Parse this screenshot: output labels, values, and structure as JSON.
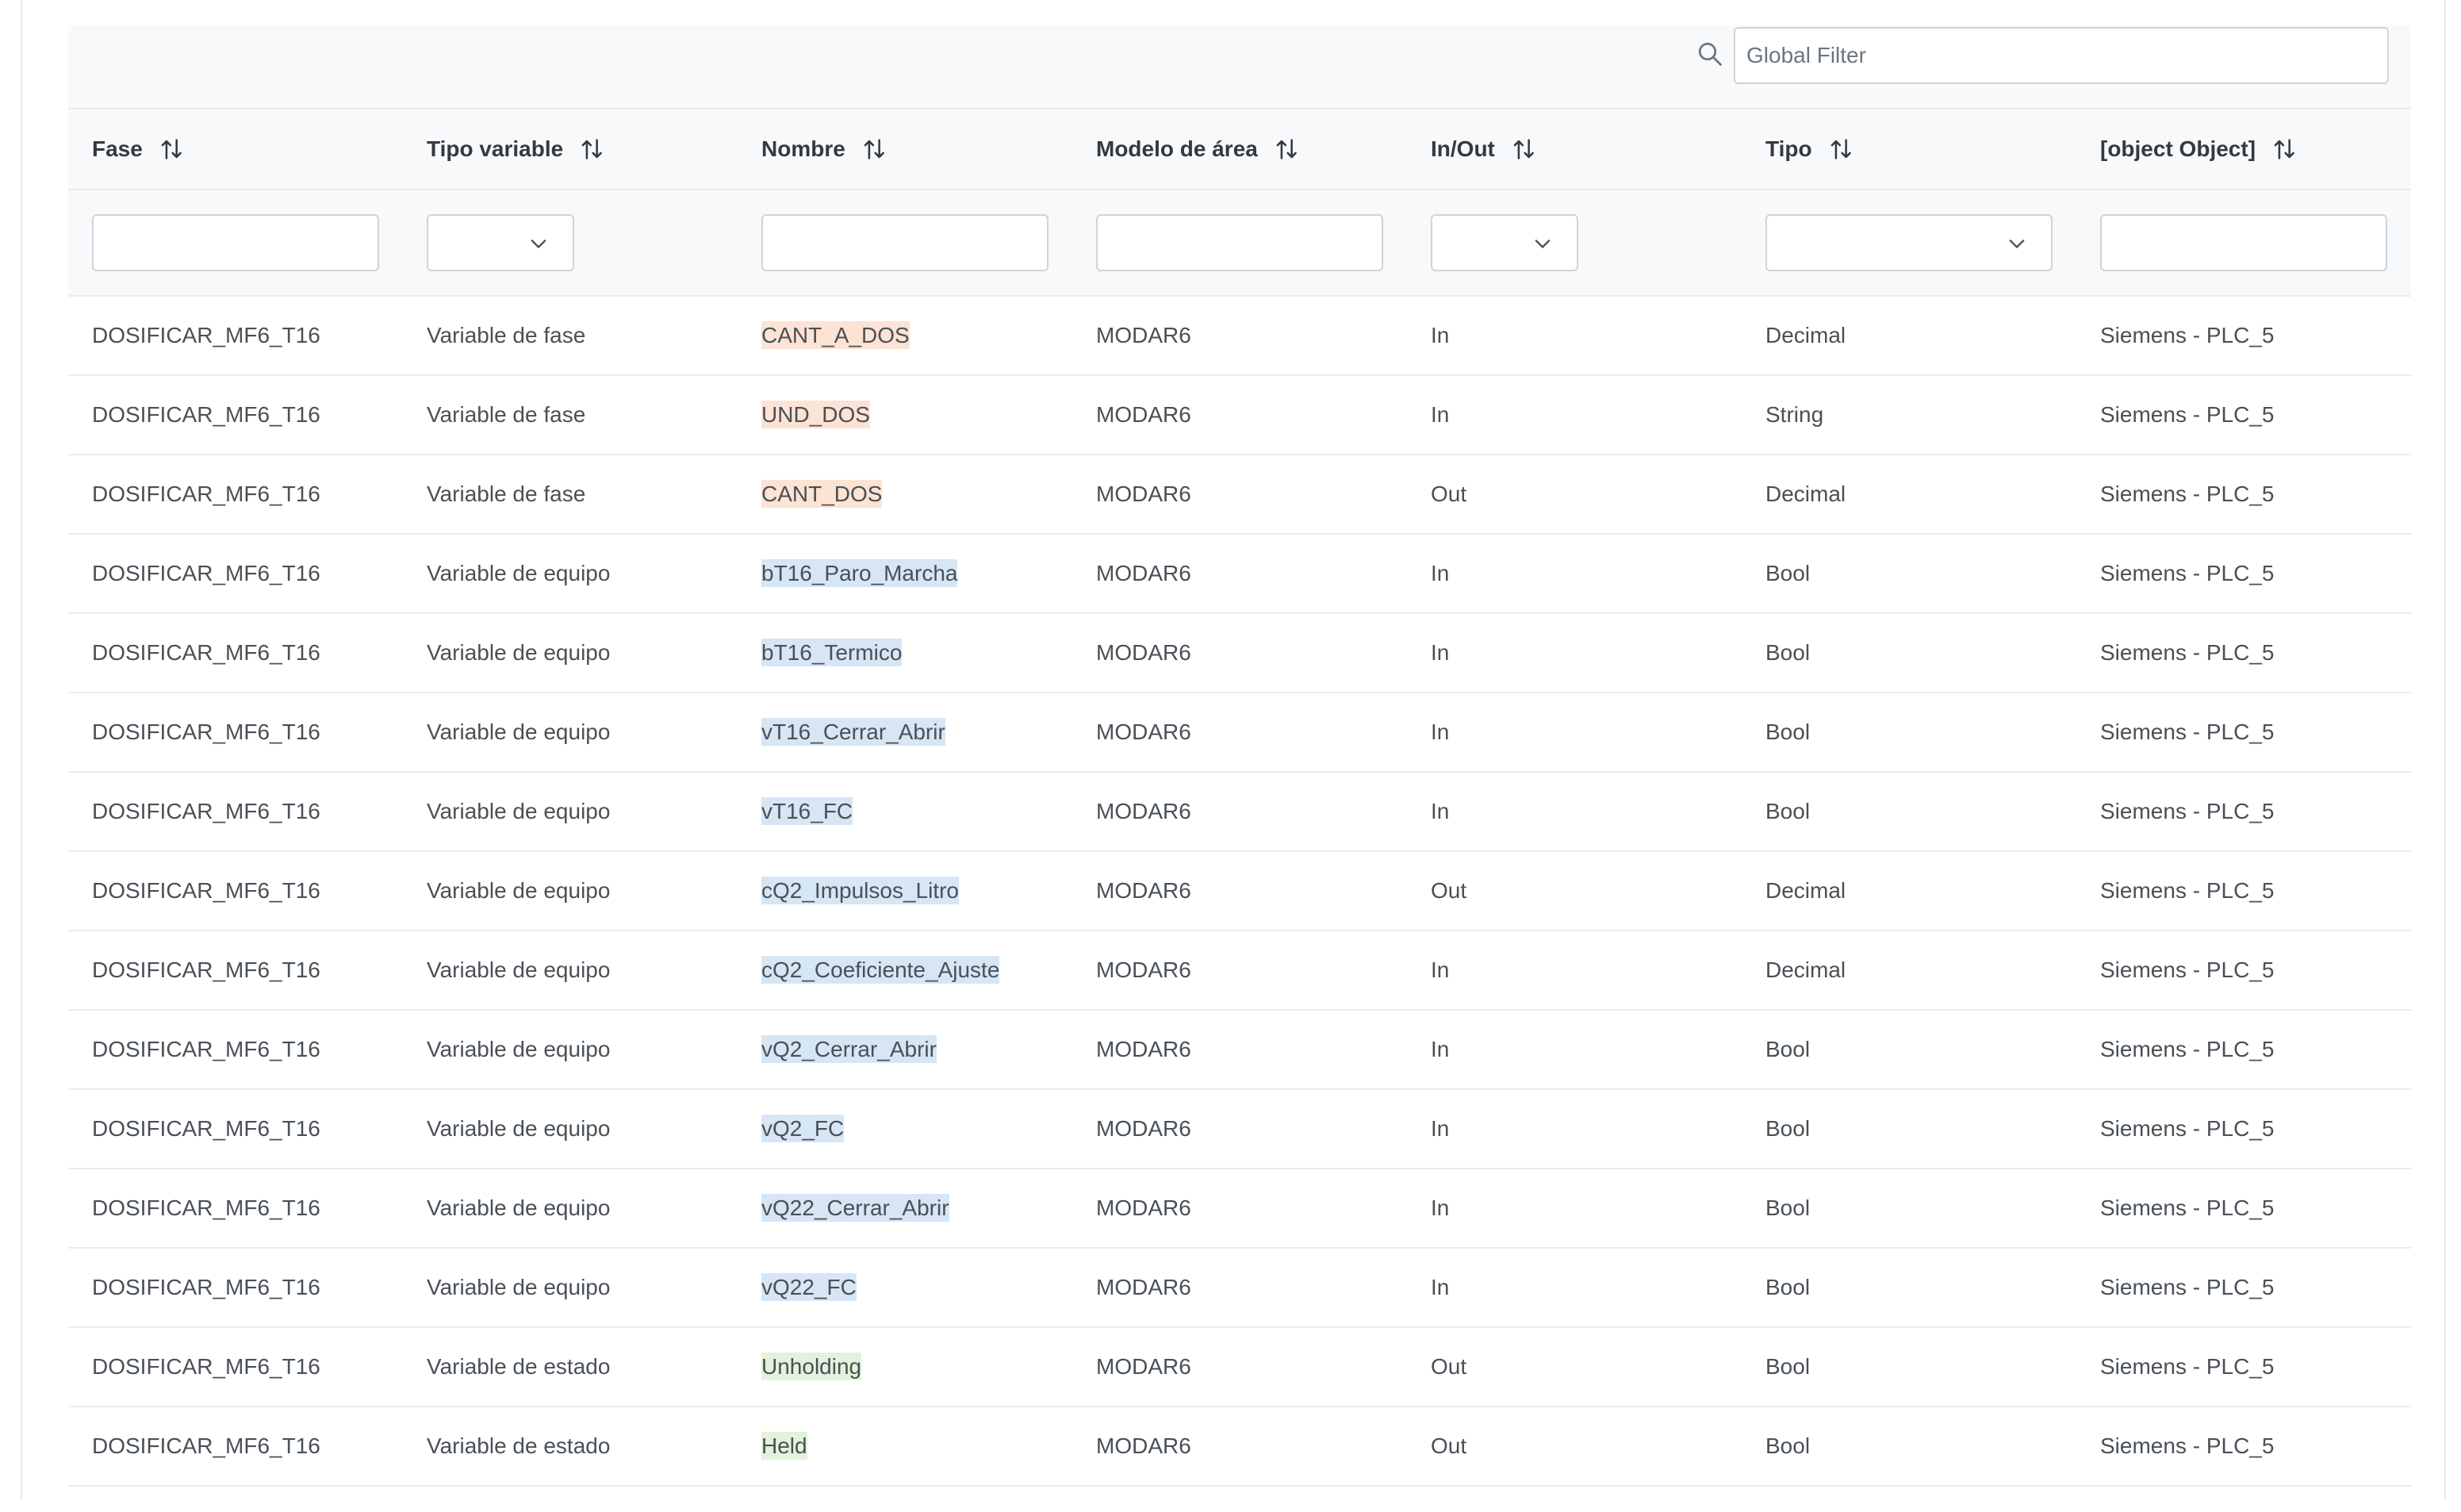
{
  "toolbar": {
    "global_filter_placeholder": "Global Filter",
    "search_icon": "search-icon"
  },
  "columns": [
    {
      "label": "Fase",
      "filter": "text"
    },
    {
      "label": "Tipo variable",
      "filter": "dropdown-small"
    },
    {
      "label": "Nombre",
      "filter": "text"
    },
    {
      "label": "Modelo de área",
      "filter": "text"
    },
    {
      "label": "In/Out",
      "filter": "dropdown-small"
    },
    {
      "label": "Tipo",
      "filter": "dropdown-large"
    },
    {
      "label": "[object Object]",
      "filter": "text"
    }
  ],
  "highlight_colors": {
    "fase": "#fde3d3",
    "equipo": "#d6e6f5",
    "estado": "#e2f2dc"
  },
  "rows": [
    {
      "fase": "DOSIFICAR_MF6_T16",
      "tipo_variable": "Variable de fase",
      "nombre": "CANT_A_DOS",
      "modelo": "MODAR6",
      "inout": "In",
      "tipo": "Decimal",
      "plc": "Siemens - PLC_5"
    },
    {
      "fase": "DOSIFICAR_MF6_T16",
      "tipo_variable": "Variable de fase",
      "nombre": "UND_DOS",
      "modelo": "MODAR6",
      "inout": "In",
      "tipo": "String",
      "plc": "Siemens - PLC_5"
    },
    {
      "fase": "DOSIFICAR_MF6_T16",
      "tipo_variable": "Variable de fase",
      "nombre": "CANT_DOS",
      "modelo": "MODAR6",
      "inout": "Out",
      "tipo": "Decimal",
      "plc": "Siemens - PLC_5"
    },
    {
      "fase": "DOSIFICAR_MF6_T16",
      "tipo_variable": "Variable de equipo",
      "nombre": "bT16_Paro_Marcha",
      "modelo": "MODAR6",
      "inout": "In",
      "tipo": "Bool",
      "plc": "Siemens - PLC_5"
    },
    {
      "fase": "DOSIFICAR_MF6_T16",
      "tipo_variable": "Variable de equipo",
      "nombre": "bT16_Termico",
      "modelo": "MODAR6",
      "inout": "In",
      "tipo": "Bool",
      "plc": "Siemens - PLC_5"
    },
    {
      "fase": "DOSIFICAR_MF6_T16",
      "tipo_variable": "Variable de equipo",
      "nombre": "vT16_Cerrar_Abrir",
      "modelo": "MODAR6",
      "inout": "In",
      "tipo": "Bool",
      "plc": "Siemens - PLC_5"
    },
    {
      "fase": "DOSIFICAR_MF6_T16",
      "tipo_variable": "Variable de equipo",
      "nombre": "vT16_FC",
      "modelo": "MODAR6",
      "inout": "In",
      "tipo": "Bool",
      "plc": "Siemens - PLC_5"
    },
    {
      "fase": "DOSIFICAR_MF6_T16",
      "tipo_variable": "Variable de equipo",
      "nombre": "cQ2_Impulsos_Litro",
      "modelo": "MODAR6",
      "inout": "Out",
      "tipo": "Decimal",
      "plc": "Siemens - PLC_5"
    },
    {
      "fase": "DOSIFICAR_MF6_T16",
      "tipo_variable": "Variable de equipo",
      "nombre": "cQ2_Coeficiente_Ajuste",
      "modelo": "MODAR6",
      "inout": "In",
      "tipo": "Decimal",
      "plc": "Siemens - PLC_5"
    },
    {
      "fase": "DOSIFICAR_MF6_T16",
      "tipo_variable": "Variable de equipo",
      "nombre": "vQ2_Cerrar_Abrir",
      "modelo": "MODAR6",
      "inout": "In",
      "tipo": "Bool",
      "plc": "Siemens - PLC_5"
    },
    {
      "fase": "DOSIFICAR_MF6_T16",
      "tipo_variable": "Variable de equipo",
      "nombre": "vQ2_FC",
      "modelo": "MODAR6",
      "inout": "In",
      "tipo": "Bool",
      "plc": "Siemens - PLC_5"
    },
    {
      "fase": "DOSIFICAR_MF6_T16",
      "tipo_variable": "Variable de equipo",
      "nombre": "vQ22_Cerrar_Abrir",
      "modelo": "MODAR6",
      "inout": "In",
      "tipo": "Bool",
      "plc": "Siemens - PLC_5"
    },
    {
      "fase": "DOSIFICAR_MF6_T16",
      "tipo_variable": "Variable de equipo",
      "nombre": "vQ22_FC",
      "modelo": "MODAR6",
      "inout": "In",
      "tipo": "Bool",
      "plc": "Siemens - PLC_5"
    },
    {
      "fase": "DOSIFICAR_MF6_T16",
      "tipo_variable": "Variable de estado",
      "nombre": "Unholding",
      "modelo": "MODAR6",
      "inout": "Out",
      "tipo": "Bool",
      "plc": "Siemens - PLC_5"
    },
    {
      "fase": "DOSIFICAR_MF6_T16",
      "tipo_variable": "Variable de estado",
      "nombre": "Held",
      "modelo": "MODAR6",
      "inout": "Out",
      "tipo": "Bool",
      "plc": "Siemens - PLC_5"
    }
  ]
}
